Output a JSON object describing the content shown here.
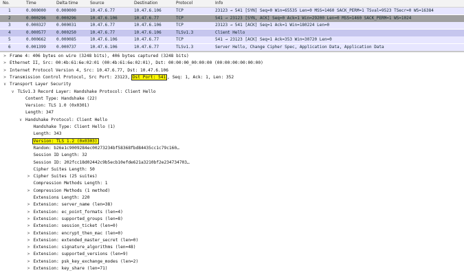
{
  "packet_list": {
    "columns": [
      "No.",
      "Time",
      "Delta time",
      "Source",
      "Destination",
      "Protocol",
      "Info"
    ],
    "rows": [
      {
        "no": "1",
        "time": "0.000000",
        "delta": "0.000000",
        "src": "10.47.6.77",
        "dst": "10.47.6.106",
        "proto": "TCP",
        "info": "23123 → 541 [SYN] Seq=0 Win=65535 Len=0 MSS=1460 SACK_PERM=1 TSval=9523 TSecr=0 WS=16384",
        "bg": "#e7e6ff",
        "fg": "#12272e"
      },
      {
        "no": "2",
        "time": "0.000296",
        "delta": "0.000296",
        "src": "10.47.6.106",
        "dst": "10.47.6.77",
        "proto": "TCP",
        "info": "541 → 23123 [SYN, ACK] Seq=0 Ack=1 Win=29200 Len=0 MSS=1460 SACK_PERM=1 WS=1024",
        "bg": "#a0a0a0",
        "fg": "#12272e"
      },
      {
        "no": "3",
        "time": "0.000327",
        "delta": "0.000031",
        "src": "10.47.6.77",
        "dst": "10.47.6.106",
        "proto": "TCP",
        "info": "23123 → 541 [ACK] Seq=1 Ack=1 Win=180224 Len=0",
        "bg": "#e7e6ff",
        "fg": "#12272e"
      },
      {
        "no": "4",
        "time": "0.000577",
        "delta": "0.000250",
        "src": "10.47.6.77",
        "dst": "10.47.6.106",
        "proto": "TLSv1.3",
        "info": "Client Hello",
        "bg": "#c6c6ee",
        "fg": "#12272e"
      },
      {
        "no": "5",
        "time": "0.000662",
        "delta": "0.000085",
        "src": "10.47.6.106",
        "dst": "10.47.6.77",
        "proto": "TCP",
        "info": "541 → 23123 [ACK] Seq=1 Ack=353 Win=30720 Len=0",
        "bg": "#e7e6ff",
        "fg": "#12272e"
      },
      {
        "no": "6",
        "time": "0.001399",
        "delta": "0.000737",
        "src": "10.47.6.106",
        "dst": "10.47.6.77",
        "proto": "TLSv1.3",
        "info": "Server Hello, Change Cipher Spec, Application Data, Application Data",
        "bg": "#e7e6ff",
        "fg": "#12272e"
      }
    ]
  },
  "tree": [
    {
      "depth": 0,
      "tog": ">",
      "text": "Frame 4: 406 bytes on wire (3248 bits), 406 bytes captured (3248 bits)"
    },
    {
      "depth": 0,
      "tog": ">",
      "text": "Ethernet II, Src: 00:4b:61:6e:02:01 (00:4b:61:6e:02:01), Dst: 00:00:00_00:00:00 (00:00:00:00:00:00)"
    },
    {
      "depth": 0,
      "tog": ">",
      "text": "Internet Protocol Version 4, Src: 10.47.6.77, Dst: 10.47.6.106"
    },
    {
      "depth": 0,
      "tog": ">",
      "text": "Transmission Control Protocol, Src Port: 23123, ",
      "hl": "Dst Port: 541",
      "after": ", Seq: 1, Ack: 1, Len: 352"
    },
    {
      "depth": 0,
      "tog": "v",
      "text": "Transport Layer Security"
    },
    {
      "depth": 1,
      "tog": "v",
      "text": "TLSv1.3 Record Layer: Handshake Protocol: Client Hello"
    },
    {
      "depth": 2,
      "tog": "",
      "text": "Content Type: Handshake (22)"
    },
    {
      "depth": 2,
      "tog": "",
      "text": "Version: TLS 1.0 (0x0301)"
    },
    {
      "depth": 2,
      "tog": "",
      "text": "Length: 347"
    },
    {
      "depth": 2,
      "tog": "v",
      "text": "Handshake Protocol: Client Hello"
    },
    {
      "depth": 3,
      "tog": "",
      "text": "Handshake Type: Client Hello (1)"
    },
    {
      "depth": 3,
      "tog": "",
      "text": "Length: 343"
    },
    {
      "depth": 3,
      "tog": "",
      "text": "",
      "hl": "Version: TLS 1.2 (0x0303)",
      "after": ""
    },
    {
      "depth": 3,
      "tog": "",
      "text": "Random: b26e1c9009284ec00273234bf58368fbd84435cc1c79c160…"
    },
    {
      "depth": 3,
      "tog": "",
      "text": "Session ID Length: 32"
    },
    {
      "depth": 3,
      "tog": "",
      "text": "Session ID: 202fcc18d02442c9b5ecb10efde621a3210bf2e234734703…"
    },
    {
      "depth": 3,
      "tog": "",
      "text": "Cipher Suites Length: 50"
    },
    {
      "depth": 3,
      "tog": ">",
      "text": "Cipher Suites (25 suites)"
    },
    {
      "depth": 3,
      "tog": "",
      "text": "Compression Methods Length: 1"
    },
    {
      "depth": 3,
      "tog": ">",
      "text": "Compression Methods (1 method)"
    },
    {
      "depth": 3,
      "tog": "",
      "text": "Extensions Length: 220"
    },
    {
      "depth": 3,
      "tog": ">",
      "text": "Extension: server_name (len=38)"
    },
    {
      "depth": 3,
      "tog": ">",
      "text": "Extension: ec_point_formats (len=4)"
    },
    {
      "depth": 3,
      "tog": ">",
      "text": "Extension: supported_groups (len=8)"
    },
    {
      "depth": 3,
      "tog": ">",
      "text": "Extension: session_ticket (len=0)"
    },
    {
      "depth": 3,
      "tog": ">",
      "text": "Extension: encrypt_then_mac (len=0)"
    },
    {
      "depth": 3,
      "tog": ">",
      "text": "Extension: extended_master_secret (len=0)"
    },
    {
      "depth": 3,
      "tog": ">",
      "text": "Extension: signature_algorithms (len=48)"
    },
    {
      "depth": 3,
      "tog": ">",
      "text": "Extension: supported_versions (len=9)"
    },
    {
      "depth": 3,
      "tog": ">",
      "text": "Extension: psk_key_exchange_modes (len=2)"
    },
    {
      "depth": 3,
      "tog": ">",
      "text": "Extension: key_share (len=71)"
    }
  ]
}
